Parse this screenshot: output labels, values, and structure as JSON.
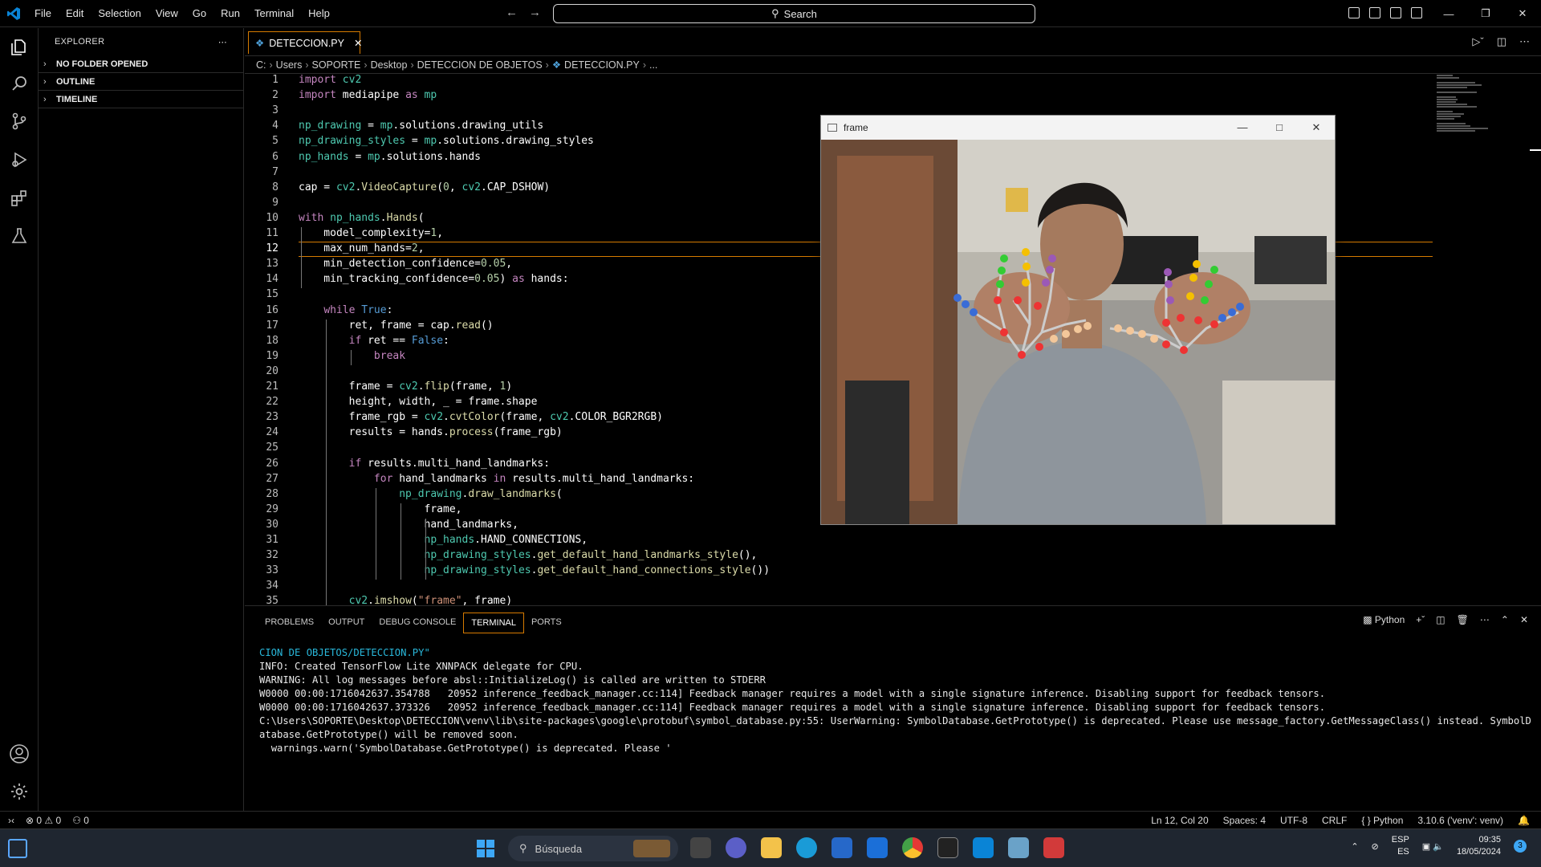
{
  "titlebar": {
    "menu": [
      "File",
      "Edit",
      "Selection",
      "View",
      "Go",
      "Run",
      "Terminal",
      "Help"
    ],
    "search": "Search"
  },
  "sidebar": {
    "title": "EXPLORER",
    "sections": [
      "NO FOLDER OPENED",
      "OUTLINE",
      "TIMELINE"
    ]
  },
  "tab": {
    "label": "DETECCION.PY"
  },
  "breadcrumb": [
    "C:",
    "Users",
    "SOPORTE",
    "Desktop",
    "DETECCION DE OBJETOS",
    "DETECCION.PY",
    "..."
  ],
  "editor": {
    "current_line": 12,
    "lines": [
      "import cv2",
      "import mediapipe as mp",
      "",
      "np_drawing = mp.solutions.drawing_utils",
      "np_drawing_styles = mp.solutions.drawing_styles",
      "np_hands = mp.solutions.hands",
      "",
      "cap = cv2.VideoCapture(0, cv2.CAP_DSHOW)",
      "",
      "with np_hands.Hands(",
      "    model_complexity=1,",
      "    max_num_hands=2,",
      "    min_detection_confidence=0.05,",
      "    min_tracking_confidence=0.05) as hands:",
      "",
      "    while True:",
      "        ret, frame = cap.read()",
      "        if ret == False:",
      "            break",
      "",
      "        frame = cv2.flip(frame, 1)",
      "        height, width, _ = frame.shape",
      "        frame_rgb = cv2.cvtColor(frame, cv2.COLOR_BGR2RGB)",
      "        results = hands.process(frame_rgb)",
      "",
      "        if results.multi_hand_landmarks:",
      "            for hand_landmarks in results.multi_hand_landmarks:",
      "                np_drawing.draw_landmarks(",
      "                    frame,",
      "                    hand_landmarks,",
      "                    np_hands.HAND_CONNECTIONS,",
      "                    np_drawing_styles.get_default_hand_landmarks_style(),",
      "                    np_drawing_styles.get_default_hand_connections_style())",
      "",
      "        cv2.imshow(\"frame\", frame)"
    ]
  },
  "frame_window": {
    "title": "frame"
  },
  "panel": {
    "tabs": [
      "PROBLEMS",
      "OUTPUT",
      "DEBUG CONSOLE",
      "TERMINAL",
      "PORTS"
    ],
    "active_tab": "TERMINAL",
    "shell": "Python",
    "terminal_lines": [
      "CION DE OBJETOS/DETECCION.PY\"",
      "INFO: Created TensorFlow Lite XNNPACK delegate for CPU.",
      "WARNING: All log messages before absl::InitializeLog() is called are written to STDERR",
      "W0000 00:00:1716042637.354788   20952 inference_feedback_manager.cc:114] Feedback manager requires a model with a single signature inference. Disabling support for feedback tensors.",
      "W0000 00:00:1716042637.373326   20952 inference_feedback_manager.cc:114] Feedback manager requires a model with a single signature inference. Disabling support for feedback tensors.",
      "C:\\Users\\SOPORTE\\Desktop\\DETECCION\\venv\\lib\\site-packages\\google\\protobuf\\symbol_database.py:55: UserWarning: SymbolDatabase.GetPrototype() is deprecated. Please use message_factory.GetMessageClass() instead. SymbolDatabase.GetPrototype() will be removed soon.",
      "  warnings.warn('SymbolDatabase.GetPrototype() is deprecated. Please '"
    ]
  },
  "status": {
    "errors": "0",
    "warnings": "0",
    "ports": "0",
    "position": "Ln 12, Col 20",
    "spaces": "Spaces: 4",
    "encoding": "UTF-8",
    "eol": "CRLF",
    "language": "Python",
    "interpreter": "3.10.6 ('venv': venv)"
  },
  "taskbar": {
    "search_placeholder": "Búsqueda",
    "lang_top": "ESP",
    "lang_bottom": "ES",
    "time": "09:35",
    "date": "18/05/2024",
    "notifications": "3"
  },
  "colors": {
    "accent": "#d67a00",
    "vscode_blue": "#0a84d6"
  }
}
